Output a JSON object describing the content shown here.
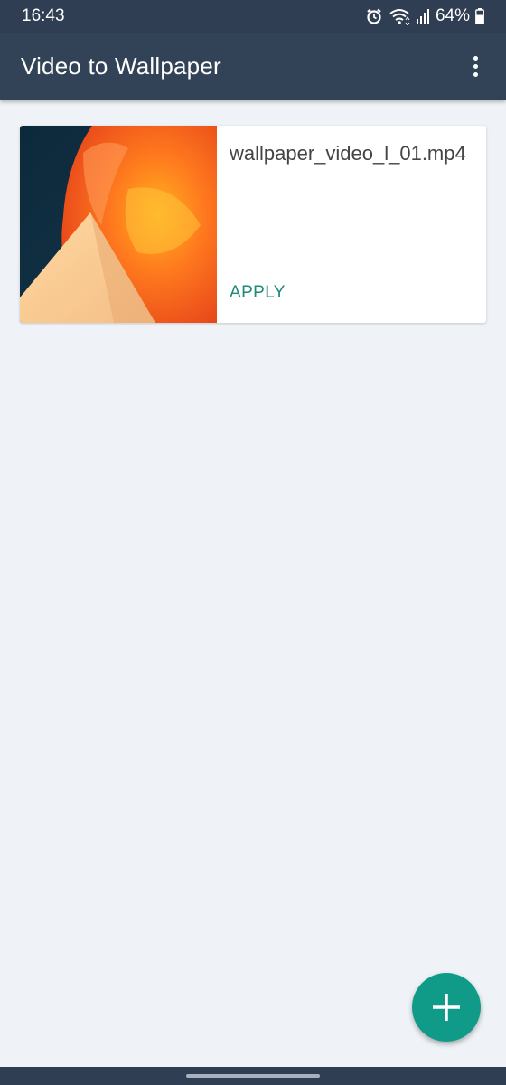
{
  "status_bar": {
    "time": "16:43",
    "battery": "64%",
    "icons": [
      "alarm-icon",
      "wifi-icon",
      "signal-icon",
      "battery-icon"
    ]
  },
  "app_bar": {
    "title": "Video to Wallpaper",
    "menu_icon": "more-vert-icon"
  },
  "videos": [
    {
      "file_name": "wallpaper_video_l_01.mp4",
      "action_label": "APPLY"
    }
  ],
  "fab": {
    "icon": "add-icon"
  },
  "colors": {
    "app_bar": "#334357",
    "status_bar": "#2f3e52",
    "background": "#eff3f7",
    "accent": "#0f9b88",
    "apply_text": "#1f8a77"
  }
}
